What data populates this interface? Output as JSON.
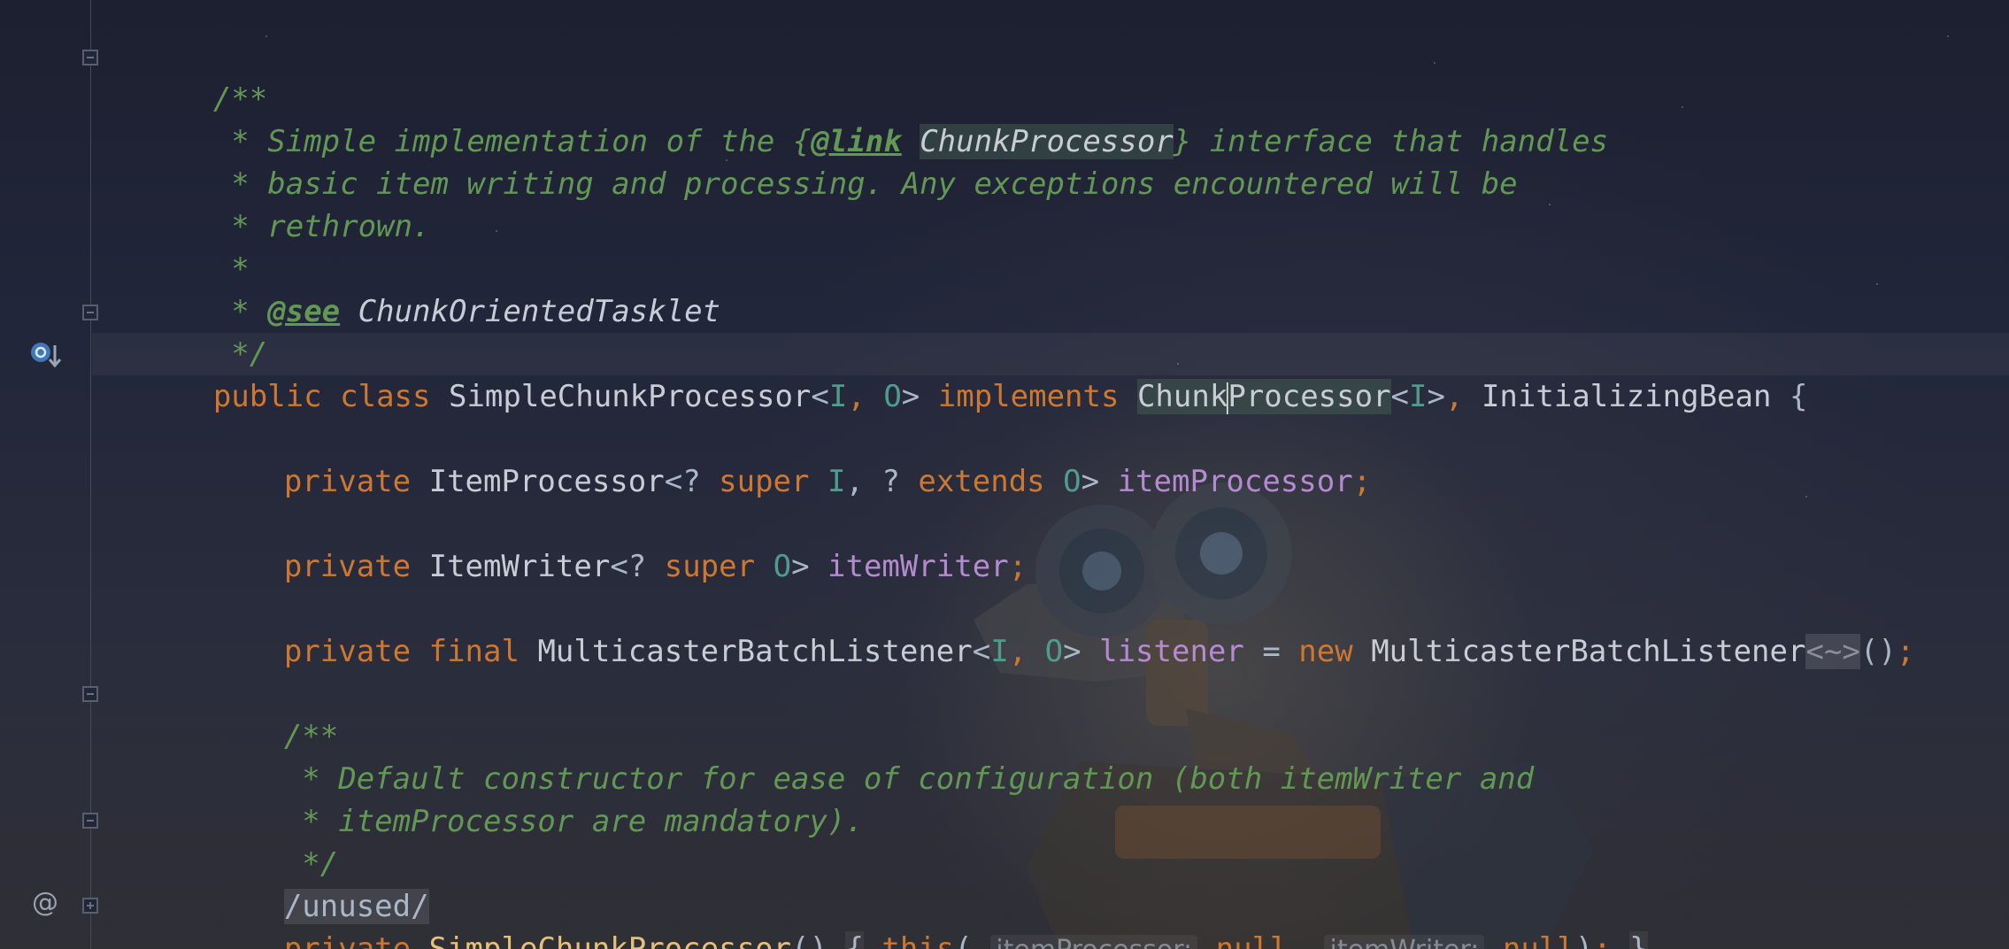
{
  "comment1": {
    "open": "/**",
    "l1_pre": " * Simple implementation of the {",
    "l1_tag": "@link",
    "l1_sp": " ",
    "l1_ref": "ChunkProcessor",
    "l1_post": "} interface that handles",
    "l2": " * basic item writing and processing. Any exceptions encountered will be",
    "l3": " * rethrown.",
    "l4": " *",
    "l5_pre": " * ",
    "l5_tag": "@see",
    "l5_sp": " ",
    "l5_ref": "ChunkOrientedTasklet",
    "close": " */"
  },
  "class_decl": {
    "kw_public": "public",
    "kw_class": "class",
    "name": "SimpleChunkProcessor",
    "lt": "<",
    "tp1": "I",
    "comma1": ", ",
    "tp2": "O",
    "gt": ">",
    "kw_implements": "implements",
    "iface_a": "Chunk",
    "iface_b": "Processor",
    "iface_lt": "<",
    "iface_tp": "I",
    "iface_gt": ">",
    "sep": ", ",
    "iface2": "InitializingBean",
    "brace": "{"
  },
  "field1": {
    "kw": "private",
    "type": "ItemProcessor",
    "lt": "<? ",
    "kw_super": "super",
    "tp1": "I",
    "mid": ", ? ",
    "kw_extends": "extends",
    "tp2": "O",
    "gt": "> ",
    "name": "itemProcessor",
    "semi": ";"
  },
  "field2": {
    "kw": "private",
    "type": "ItemWriter",
    "lt": "<? ",
    "kw_super": "super",
    "tp": "O",
    "gt": "> ",
    "name": "itemWriter",
    "semi": ";"
  },
  "field3": {
    "kw": "private",
    "kw_final": "final",
    "type": "MulticasterBatchListener",
    "lt": "<",
    "tp1": "I",
    "comma": ", ",
    "tp2": "O",
    "gt": "> ",
    "name": "listener",
    "eq": " = ",
    "kw_new": "new",
    "ctor": "MulticasterBatchListener",
    "diamond": "<~>",
    "call": "()",
    "semi": ";"
  },
  "comment2": {
    "open": "/**",
    "l1": " * Default constructor for ease of configuration (both itemWriter and",
    "l2": " * itemProcessor are mandatory).",
    "close": " */"
  },
  "annotation": "/unused/",
  "ctor": {
    "kw": "private",
    "name": "SimpleChunkProcessor",
    "parens": "()",
    "open": "{",
    "kw_this": "this",
    "lparen": "(",
    "hint1": "itemProcessor:",
    "null1": "null",
    "comma": ",",
    "hint2": "itemWriter:",
    "null2": "null",
    "rparen": ")",
    "semi": ";",
    "close": "}"
  },
  "gutter": {
    "impl_icon": "implementation-marker-icon",
    "anno_icon": "@"
  },
  "colors": {
    "keyword": "#cc7832",
    "doc_comment": "#629755",
    "field": "#b58bcf",
    "type_param": "#4f9c8c",
    "plain": "#a9b7c6"
  }
}
